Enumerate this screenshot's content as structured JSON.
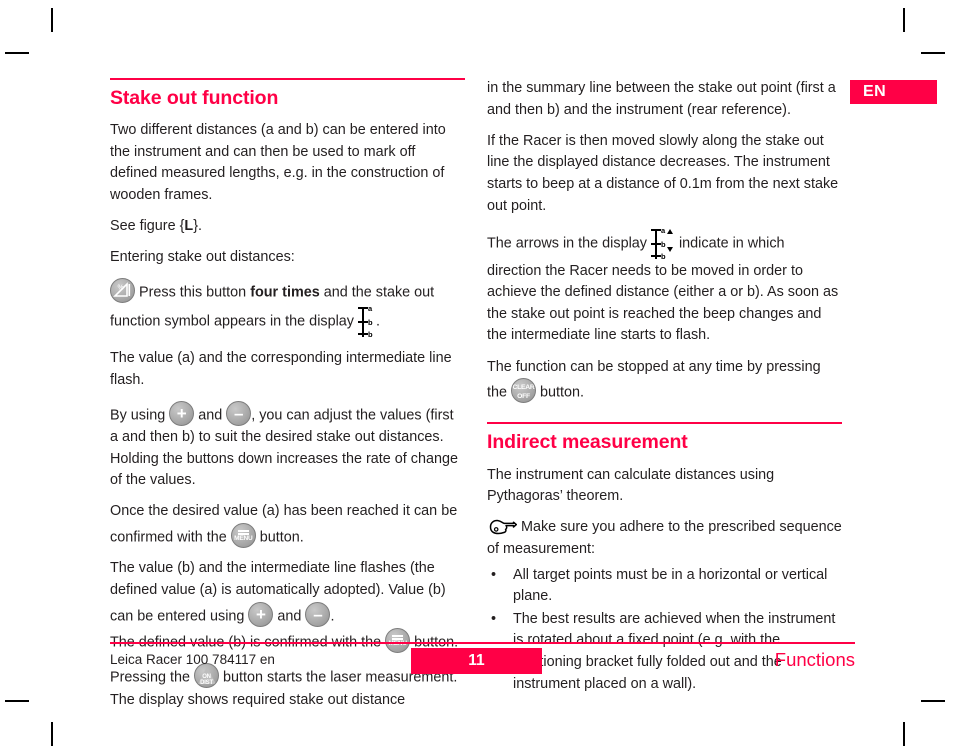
{
  "page": {
    "language_badge": "EN"
  },
  "left_column": {
    "heading": "Stake out function",
    "p1": "Two different distances (a and b) can be entered into the instrument and can then be used to mark off defined measured lengths, e.g. in the construction of wooden frames.",
    "p2_prefix": "See figure {",
    "p2_bold": "L",
    "p2_suffix": "}.",
    "p3": "Entering stake out distances:",
    "p4_a": "Press this button ",
    "p4_bold": "four times",
    "p4_b": " and the stake out function symbol appears in the display ",
    "p4_c": ".",
    "p5": "The value (a) and the corresponding intermediate line flash.",
    "p6_a": "By using ",
    "p6_b": " and ",
    "p6_c": ", you can adjust the values (first a and then b) to suit the desired stake out distances. Holding the buttons down increases the rate of change of the values.",
    "p7_a": "Once the desired value (a) has been reached it can be confirmed with the ",
    "p7_b": " button.",
    "p8_a": "The value (b) and the intermediate line flashes (the defined value (a) is automatically adopted). Value (b) can be entered using ",
    "p8_b": " and ",
    "p8_c": ".",
    "p9_a": "The defined value (b) is confirmed with the ",
    "p9_b": " button.",
    "p10_a": "Pressing the ",
    "p10_b": " button starts the laser measurement. The display shows required stake out distance"
  },
  "right_column": {
    "p1": "in the summary line between the stake out point (first a and then b) and the instrument (rear reference).",
    "p2": "If the Racer is then moved slowly along the stake out line the displayed distance decreases. The instrument starts to beep at a distance of 0.1m from the next stake out point.",
    "p3_a": "The arrows in the display ",
    "p3_b": " indicate in which direction the Racer needs to be moved in order to achieve the defined distance (either a or b). As soon as the stake out point is reached the beep changes and the intermediate line starts to flash.",
    "p4_a": "The function can be stopped at any time by pressing the ",
    "p4_b": " button.",
    "heading": "Indirect measurement",
    "p5": "The instrument can calculate distances using Pythagoras’ theorem.",
    "p6": "Make sure you adhere to the prescribed sequence of measurement:",
    "bullets": [
      {
        "marker": "•",
        "text": "All target points must be in a horizontal or vertical plane."
      },
      {
        "marker": "•",
        "text": "The best results are achieved when the instrument is rotated about a fixed point (e.g. with the positioning bracket fully folded out and the instrument placed on a wall)."
      }
    ]
  },
  "keys": {
    "plus": "+",
    "minus": "–",
    "menu_label": "MENU",
    "clear_line1": "CLEAR",
    "clear_line2": "OFF",
    "ondist_line1": "ON",
    "ondist_line2": "DIST"
  },
  "display_symbol": {
    "label_a": "a",
    "label_b1": "b",
    "label_b2": "b"
  },
  "footer": {
    "left": "Leica Racer 100 784117 en",
    "page_number": "11",
    "right": "Functions"
  },
  "colors": {
    "accent": "#ff0046",
    "text": "#231f20",
    "key_gray": "#a8a8a8"
  }
}
